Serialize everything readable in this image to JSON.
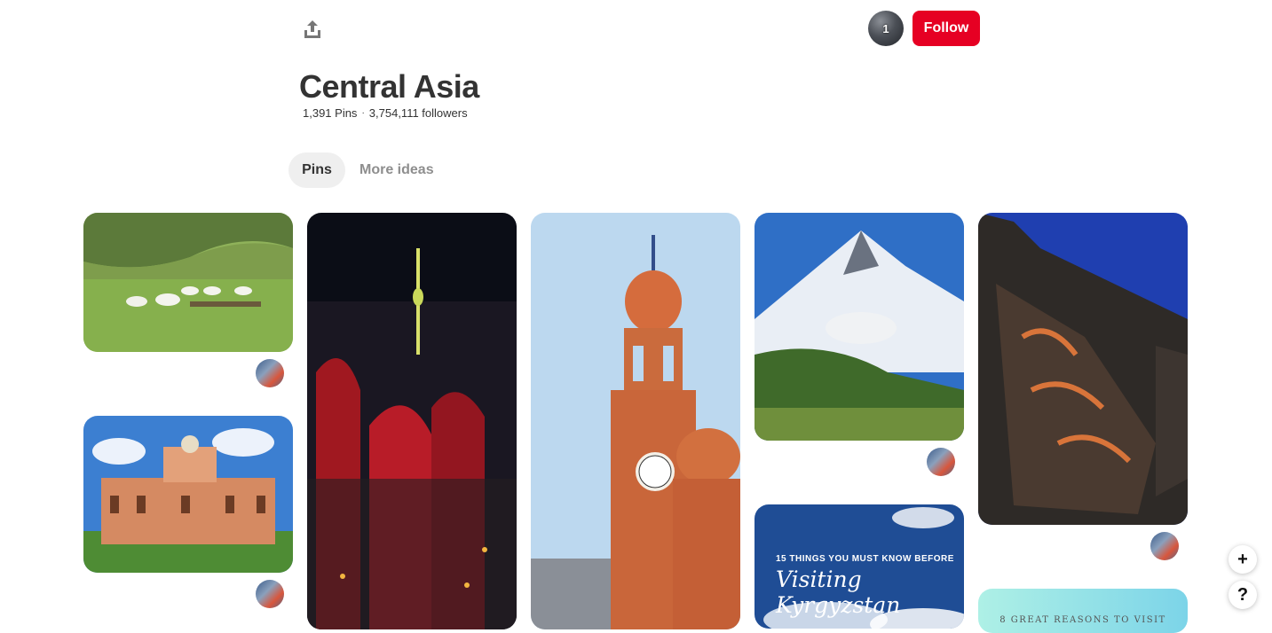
{
  "header": {
    "share_icon": "share-upload-icon",
    "owner_avatar_count": "1",
    "follow_label": "Follow"
  },
  "board": {
    "title": "Central Asia",
    "pins_count": "1,391 Pins",
    "followers_count": "3,754,111 followers",
    "separator": "·"
  },
  "tabs": [
    {
      "label": "Pins",
      "selected": true
    },
    {
      "label": "More ideas",
      "selected": false
    }
  ],
  "pins": {
    "kyrgyzstan_title_line1": "15 THINGS YOU MUST KNOW BEFORE",
    "kyrgyzstan_title_line2": "Visiting Kyrgyzstan",
    "reasons_title": "8 GREAT REASONS TO VISIT"
  },
  "floating": {
    "add_label": "+",
    "help_label": "?"
  },
  "colors": {
    "accent": "#e60023",
    "tab_selected_bg": "#efefef",
    "muted_text": "#8e8e8e"
  }
}
